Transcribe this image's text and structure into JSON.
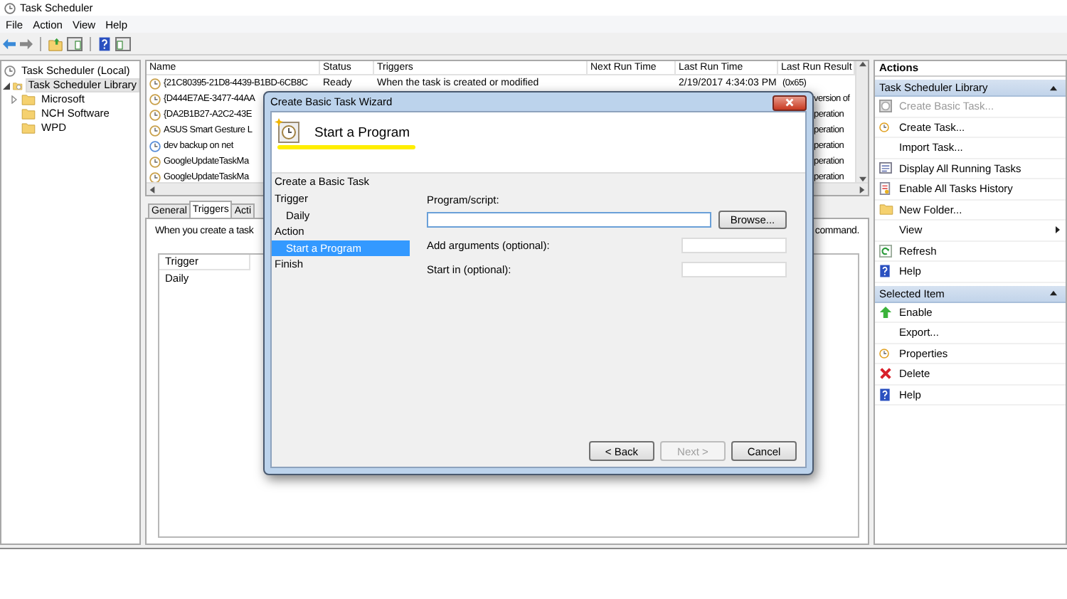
{
  "window": {
    "title": "Task Scheduler"
  },
  "menu": [
    "File",
    "Action",
    "View",
    "Help"
  ],
  "tree": [
    {
      "label": "Task Scheduler (Local)",
      "kind": "root",
      "has_children": false,
      "selected": false,
      "children": [
        {
          "label": "Task Scheduler Library",
          "kind": "library",
          "has_children": true,
          "expanded": true,
          "selected": true,
          "children": [
            {
              "label": "Microsoft",
              "kind": "folder",
              "has_children": true,
              "expanded": false,
              "selected": false
            },
            {
              "label": "NCH Software",
              "kind": "folder",
              "has_children": false,
              "selected": false
            },
            {
              "label": "WPD",
              "kind": "folder",
              "has_children": false,
              "selected": false
            }
          ]
        }
      ]
    }
  ],
  "task_list": {
    "columns": [
      "Name",
      "Status",
      "Triggers",
      "Next Run Time",
      "Last Run Time",
      "Last Run Result"
    ],
    "rows": [
      {
        "name": "{21C80395-21D8-4439-B1BD-6CB8C",
        "status": "Ready",
        "triggers": "When the task is created or modified",
        "last_run_time": "2/19/2017 4:34:03 PM",
        "last_run_result": "(0x65)"
      },
      {
        "name": "{D444E7AE-3477-44AA",
        "last_run_result": "version of"
      },
      {
        "name": "{DA2B1B27-A2C2-43E",
        "last_run_result": "peration"
      },
      {
        "name": "ASUS Smart Gesture L",
        "last_run_result": "peration"
      },
      {
        "name": "dev backup on net",
        "last_run_result": "peration"
      },
      {
        "name": "GoogleUpdateTaskMa",
        "last_run_result": "peration"
      },
      {
        "name": "GoogleUpdateTaskMa",
        "last_run_result": "peration"
      }
    ]
  },
  "details": {
    "tabs": [
      {
        "label": "General",
        "selected": false
      },
      {
        "label": "Triggers",
        "selected": true
      },
      {
        "label": "Acti",
        "selected": false
      }
    ],
    "description_start": "When you create a task",
    "description_end": "command.",
    "trigger_table": {
      "columns": [
        "Trigger"
      ],
      "rows": [
        [
          "Daily"
        ]
      ]
    }
  },
  "actions": {
    "title": "Actions",
    "sections": [
      {
        "title": "Task Scheduler Library",
        "items": [
          {
            "label": "Create Basic Task...",
            "kind": "wizard",
            "disabled": true,
            "submenu": false
          },
          {
            "label": "Create Task...",
            "kind": "task",
            "disabled": false,
            "submenu": false
          },
          {
            "label": "Import Task...",
            "kind": "plain",
            "disabled": false,
            "submenu": false
          },
          {
            "label": "Display All Running Tasks",
            "kind": "running",
            "disabled": false,
            "submenu": false
          },
          {
            "label": "Enable All Tasks History",
            "kind": "history",
            "disabled": false,
            "submenu": false
          },
          {
            "label": "New Folder...",
            "kind": "folder",
            "disabled": false,
            "submenu": false
          },
          {
            "label": "View",
            "kind": "plain",
            "disabled": false,
            "submenu": true
          },
          {
            "label": "Refresh",
            "kind": "refresh",
            "disabled": false,
            "submenu": false
          },
          {
            "label": "Help",
            "kind": "help",
            "disabled": false,
            "submenu": false
          }
        ]
      },
      {
        "title": "Selected Item",
        "items": [
          {
            "label": "Enable",
            "kind": "enable",
            "disabled": false,
            "submenu": false
          },
          {
            "label": "Export...",
            "kind": "plain",
            "disabled": false,
            "submenu": false
          },
          {
            "label": "Properties",
            "kind": "task",
            "disabled": false,
            "submenu": false
          },
          {
            "label": "Delete",
            "kind": "delete",
            "disabled": false,
            "submenu": false
          },
          {
            "label": "Help",
            "kind": "help",
            "disabled": false,
            "submenu": false
          }
        ]
      }
    ]
  },
  "wizard": {
    "title": "Create Basic Task Wizard",
    "heading": "Start a Program",
    "heading_highlighted": true,
    "steps_title": "Create a Basic Task",
    "steps": [
      {
        "label": "Trigger",
        "selected": false,
        "children": [
          {
            "label": "Daily",
            "selected": false
          }
        ]
      },
      {
        "label": "Action",
        "selected": false,
        "children": [
          {
            "label": "Start a Program",
            "selected": true
          }
        ]
      },
      {
        "label": "Finish",
        "selected": false
      }
    ],
    "fields": [
      {
        "label": "Program/script:",
        "kind": "wide",
        "focused": true,
        "button": "Browse..."
      },
      {
        "label": "Add arguments (optional):",
        "kind": "inline",
        "focused": false
      },
      {
        "label": "Start in (optional):",
        "kind": "inline",
        "focused": false
      }
    ],
    "buttons": [
      {
        "label": "< Back",
        "disabled": false
      },
      {
        "label": "Next >",
        "disabled": true
      },
      {
        "label": "Cancel",
        "disabled": false
      }
    ]
  }
}
